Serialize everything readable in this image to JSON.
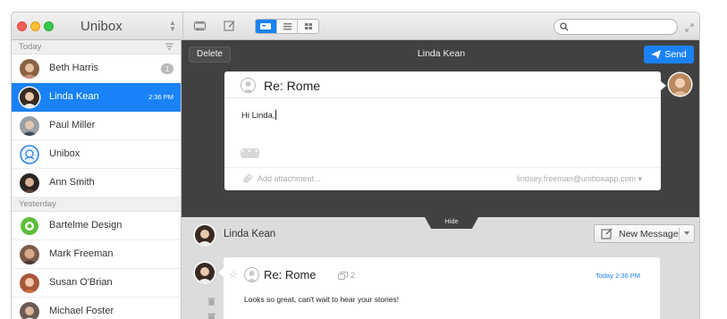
{
  "toolbar": {
    "app_title": "Unibox",
    "search_placeholder": "",
    "view_modes": [
      "conversation",
      "list",
      "grid"
    ],
    "active_view": "conversation"
  },
  "sidebar": {
    "sections": [
      {
        "header": "Today",
        "contacts": [
          {
            "name": "Beth Harris",
            "badge": "1",
            "avatar": "photo-woman-brown-hair"
          },
          {
            "name": "Linda Kean",
            "time": "2:36 PM",
            "selected": true,
            "avatar": "photo-woman-dark-hair"
          },
          {
            "name": "Paul Miller",
            "avatar": "photo-man-gray-hair"
          },
          {
            "name": "Unibox",
            "avatar": "unibox-logo-icon"
          },
          {
            "name": "Ann Smith",
            "avatar": "photo-woman-dark-curly-hair"
          }
        ]
      },
      {
        "header": "Yesterday",
        "contacts": [
          {
            "name": "Bartelme Design",
            "avatar": "bartelme-logo-icon"
          },
          {
            "name": "Mark Freeman",
            "avatar": "photo-man-bald"
          },
          {
            "name": "Susan O'Brian",
            "avatar": "photo-woman-red-hair"
          },
          {
            "name": "Michael Foster",
            "avatar": "photo-man-short-hair"
          }
        ]
      }
    ]
  },
  "compose": {
    "delete_label": "Delete",
    "title": "Linda Kean",
    "send_label": "Send",
    "subject": "Re: Rome",
    "body": "Hi Linda,",
    "attachment_placeholder": "Add attachment...",
    "from_address": "lindsey.freeman@uniboxapp.com"
  },
  "hide_label": "Hide",
  "thread": {
    "contact_name": "Linda Kean",
    "new_message_label": "New Message",
    "message": {
      "subject": "Re: Rome",
      "thread_count": "2",
      "date": "Today 2:36 PM",
      "body": "Looks so great, can't wait to hear your stories!"
    }
  },
  "colors": {
    "accent": "#1a82f7",
    "compose_bg": "#414141",
    "thread_bg": "#dcdcdc",
    "sidebar_header_bg": "#efefef"
  }
}
